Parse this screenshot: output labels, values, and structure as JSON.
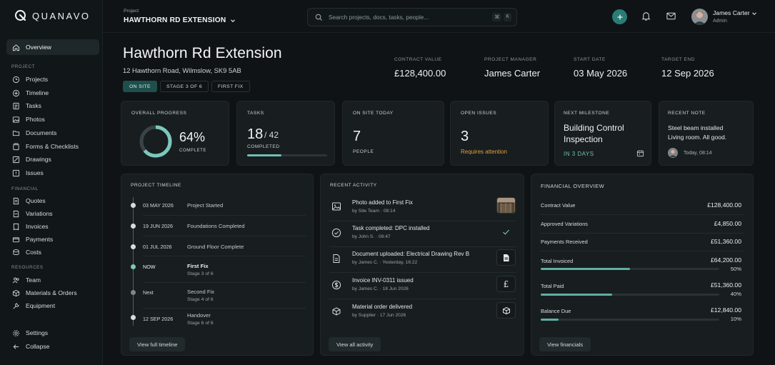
{
  "app": {
    "logo_text": "QUANAVO"
  },
  "sidebar": {
    "overview": "Overview",
    "section_project": "PROJECT",
    "section_financial": "FINANCIAL",
    "section_resources": "RESOURCES",
    "project_items": [
      "Projects",
      "Timeline",
      "Tasks",
      "Photos",
      "Documents",
      "Forms & Checklists",
      "Drawings",
      "Issues"
    ],
    "financial_items": [
      "Quotes",
      "Variations",
      "Invoices",
      "Payments",
      "Costs"
    ],
    "resources_items": [
      "Team",
      "Materials & Orders",
      "Equipment"
    ],
    "settings": "Settings",
    "collapse": "Collapse"
  },
  "header": {
    "project_label": "Project",
    "project_name": "HAWTHORN RD EXTENSION",
    "search_placeholder": "Search projects, docs, tasks, people...",
    "kbd": [
      "⌘",
      "K"
    ],
    "user_name": "James Carter",
    "user_role": "Admin"
  },
  "project": {
    "title": "Hawthorn Rd Extension",
    "address": "12 Hawthorn Road, Wilmslow, SK9 5AB",
    "badges": [
      "ON SITE",
      "STAGE 3 OF 6",
      "FIRST FIX"
    ],
    "meta": [
      {
        "label": "CONTRACT VALUE",
        "value": "£128,400.00"
      },
      {
        "label": "PROJECT MANAGER",
        "value": "James Carter"
      },
      {
        "label": "START DATE",
        "value": "03 May 2026"
      },
      {
        "label": "TARGET END",
        "value": "12 Sep 2026"
      }
    ]
  },
  "stats": {
    "progress": {
      "label": "OVERALL PROGRESS",
      "value": "64%",
      "sub": "COMPLETE",
      "fraction": 0.64
    },
    "tasks": {
      "label": "TASKS",
      "done": "18",
      "total": "/ 42",
      "sub": "COMPLETED",
      "fraction": 0.4286
    },
    "onsite": {
      "label": "ON SITE TODAY",
      "value": "7",
      "sub": "PEOPLE"
    },
    "issues": {
      "label": "OPEN ISSUES",
      "value": "3",
      "sub": "Requires attention"
    },
    "milestone": {
      "label": "NEXT MILESTONE",
      "line1": "Building Control",
      "line2": "Inspection",
      "due": "IN 3 DAYS"
    },
    "note": {
      "label": "RECENT NOTE",
      "line1": "Steel beam installed",
      "line2": "Living room. All good.",
      "time": "Today, 08:14"
    }
  },
  "timeline": {
    "title": "PROJECT TIMELINE",
    "rows": [
      {
        "date": "03 MAY 2026",
        "text": "Project Started",
        "sub": ""
      },
      {
        "date": "19 JUN 2026",
        "text": "Foundations Completed",
        "sub": ""
      },
      {
        "date": "01 JUL 2026",
        "text": "Ground Floor Complete",
        "sub": ""
      },
      {
        "date": "NOW",
        "text": "First Fix",
        "sub": "Stage 3 of 6"
      },
      {
        "date": "Next",
        "text": "Second Fix",
        "sub": "Stage 4 of 6"
      },
      {
        "date": "12 SEP 2026",
        "text": "Handover",
        "sub": "Stage 6 of 6"
      }
    ],
    "button": "View full timeline"
  },
  "activity": {
    "title": "RECENT ACTIVITY",
    "rows": [
      {
        "title": "Photo added to First Fix",
        "by": "by Site Team",
        "time": "08:14",
        "icon": "image-icon"
      },
      {
        "title": "Task completed: DPC installed",
        "by": "by John S.",
        "time": "08:47",
        "icon": "check-circle-icon"
      },
      {
        "title": "Document uploaded: Electrical Drawing Rev B",
        "by": "by James C.",
        "time": "Yesterday, 16:22",
        "icon": "document-icon"
      },
      {
        "title": "Invoice INV-0311 issued",
        "by": "by James C.",
        "time": "18 Jun 2026",
        "icon": "dollar-circle-icon"
      },
      {
        "title": "Material order delivered",
        "by": "by Supplier",
        "time": "17 Jun 2026",
        "icon": "box-icon"
      }
    ],
    "button": "View all activity"
  },
  "financial": {
    "title": "FINANCIAL OVERVIEW",
    "rows": [
      {
        "label": "Contract Value",
        "value": "£128,400.00"
      },
      {
        "label": "Approved Variations",
        "value": "£4,850.00"
      },
      {
        "label": "Payments Received",
        "value": "£51,360.00"
      }
    ],
    "bars": [
      {
        "label": "Total Invoiced",
        "value": "£64,200.00",
        "pct": "50%",
        "fraction": 0.5
      },
      {
        "label": "Total Paid",
        "value": "£51,360.00",
        "pct": "40%",
        "fraction": 0.4
      },
      {
        "label": "Balance Due",
        "value": "£12,840.00",
        "pct": "10%",
        "fraction": 0.1
      }
    ],
    "button": "View financials"
  },
  "colors": {
    "accent": "#5fb0a5",
    "warning": "#e0a23a",
    "background": "#0f1315"
  }
}
